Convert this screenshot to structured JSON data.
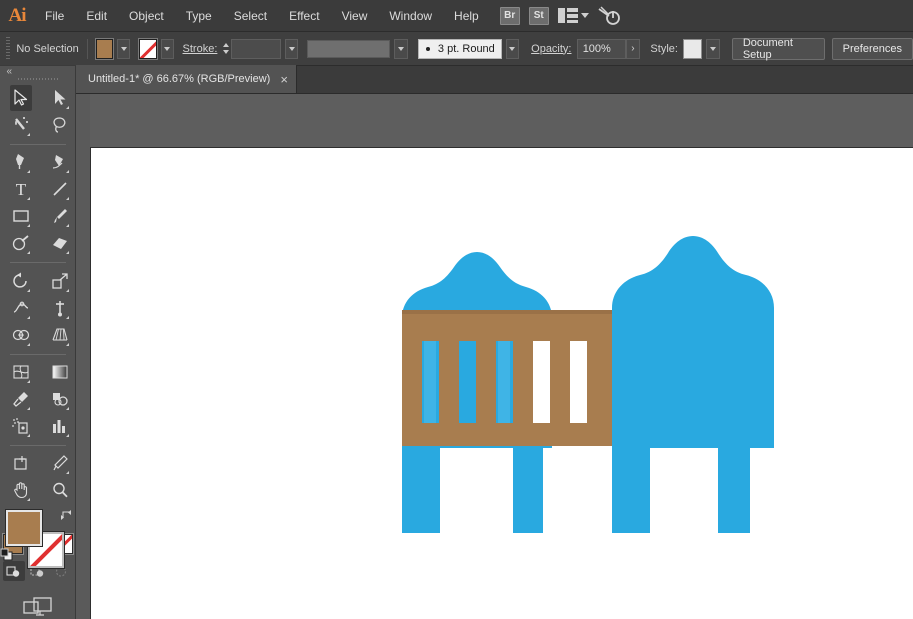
{
  "app": {
    "name": "Adobe Illustrator",
    "logo_text": "Ai"
  },
  "menubar": {
    "items": [
      {
        "label": "File"
      },
      {
        "label": "Edit"
      },
      {
        "label": "Object"
      },
      {
        "label": "Type"
      },
      {
        "label": "Select"
      },
      {
        "label": "Effect"
      },
      {
        "label": "View"
      },
      {
        "label": "Window"
      },
      {
        "label": "Help"
      }
    ],
    "icons": [
      {
        "name": "bridge-icon",
        "label": "Br"
      },
      {
        "name": "stock-icon",
        "label": "St"
      },
      {
        "name": "arrange-documents-icon",
        "label": ""
      },
      {
        "name": "arrange-chevron-icon",
        "label": ""
      },
      {
        "name": "search-adobe-stock-icon",
        "label": ""
      }
    ]
  },
  "control_bar": {
    "selection_status": "No Selection",
    "fill_color": "#a87d4f",
    "fill_label": "Fill",
    "stroke_color": "none",
    "stroke_label": "Stroke:",
    "stroke_weight": "",
    "variable_width_profile": "",
    "brush_definition": "3 pt. Round",
    "opacity_label": "Opacity:",
    "opacity_value": "100%",
    "opacity_more": "›",
    "style_label": "Style:",
    "style_swatch_color": "#e9e9e9",
    "document_setup_label": "Document Setup",
    "preferences_label": "Preferences"
  },
  "tabs": [
    {
      "title": "Untitled-1* @ 66.67% (RGB/Preview)",
      "close": "×",
      "active": true
    }
  ],
  "toolbar": {
    "collapse_glyph": "«",
    "tools": [
      {
        "name": "selection-tool",
        "label": "Selection Tool",
        "active": true
      },
      {
        "name": "direct-selection-tool",
        "label": "Direct Selection Tool",
        "active": false
      },
      {
        "name": "magic-wand-tool",
        "label": "Magic Wand Tool",
        "active": false
      },
      {
        "name": "lasso-tool",
        "label": "Lasso Tool",
        "active": false
      },
      {
        "name": "pen-tool",
        "label": "Pen Tool",
        "active": false
      },
      {
        "name": "curvature-tool",
        "label": "Curvature Tool",
        "active": false
      },
      {
        "name": "type-tool",
        "label": "Type Tool",
        "active": false
      },
      {
        "name": "line-segment-tool",
        "label": "Line Segment Tool",
        "active": false
      },
      {
        "name": "rectangle-tool",
        "label": "Rectangle Tool",
        "active": false
      },
      {
        "name": "paintbrush-tool",
        "label": "Paintbrush Tool",
        "active": false
      },
      {
        "name": "shaper-tool",
        "label": "Shaper Tool",
        "active": false
      },
      {
        "name": "eraser-tool",
        "label": "Eraser Tool",
        "active": false
      },
      {
        "name": "rotate-tool",
        "label": "Rotate Tool",
        "active": false
      },
      {
        "name": "scale-tool",
        "label": "Scale Tool",
        "active": false
      },
      {
        "name": "width-tool",
        "label": "Width Tool",
        "active": false
      },
      {
        "name": "free-transform-tool",
        "label": "Free Transform Tool",
        "active": false
      },
      {
        "name": "shape-builder-tool",
        "label": "Shape Builder Tool",
        "active": false
      },
      {
        "name": "perspective-grid-tool",
        "label": "Perspective Grid Tool",
        "active": false
      },
      {
        "name": "mesh-tool",
        "label": "Mesh Tool",
        "active": false
      },
      {
        "name": "gradient-tool",
        "label": "Gradient Tool",
        "active": false
      },
      {
        "name": "eyedropper-tool",
        "label": "Eyedropper Tool",
        "active": false
      },
      {
        "name": "blend-tool",
        "label": "Blend Tool",
        "active": false
      },
      {
        "name": "symbol-sprayer-tool",
        "label": "Symbol Sprayer Tool",
        "active": false
      },
      {
        "name": "column-graph-tool",
        "label": "Column Graph Tool",
        "active": false
      },
      {
        "name": "artboard-tool",
        "label": "Artboard Tool",
        "active": false
      },
      {
        "name": "slice-tool",
        "label": "Slice Tool",
        "active": false
      },
      {
        "name": "hand-tool",
        "label": "Hand Tool",
        "active": false
      },
      {
        "name": "zoom-tool",
        "label": "Zoom Tool",
        "active": false
      }
    ],
    "color_controls": {
      "fill_color": "#a87d4f",
      "stroke_color": "none",
      "swap_label": "Swap Fill and Stroke",
      "default_label": "Default Fill and Stroke",
      "modes": [
        {
          "name": "color-mode-button",
          "label": "Color"
        },
        {
          "name": "gradient-mode-button",
          "label": "Gradient"
        },
        {
          "name": "none-mode-button",
          "label": "None"
        }
      ],
      "draw_modes": [
        {
          "name": "draw-normal-button",
          "label": "Draw Normal",
          "active": true
        },
        {
          "name": "draw-behind-button",
          "label": "Draw Behind",
          "active": false
        },
        {
          "name": "draw-inside-button",
          "label": "Draw Inside",
          "active": false
        }
      ],
      "screen_mode_label": "Change Screen Mode"
    }
  },
  "canvas": {
    "zoom_level": "66.67%",
    "color_mode": "RGB/Preview",
    "background": "#5e5e5e",
    "artboard_background": "#ffffff",
    "artwork": {
      "name": "baby-crib-illustration",
      "colors": {
        "blue": "#29a9e0",
        "brown": "#a87d4f",
        "white": "#ffffff"
      },
      "description": "Baby crib / cot icon with two arched headboards, a brown side rail with five vertical slats, and four legs"
    }
  }
}
